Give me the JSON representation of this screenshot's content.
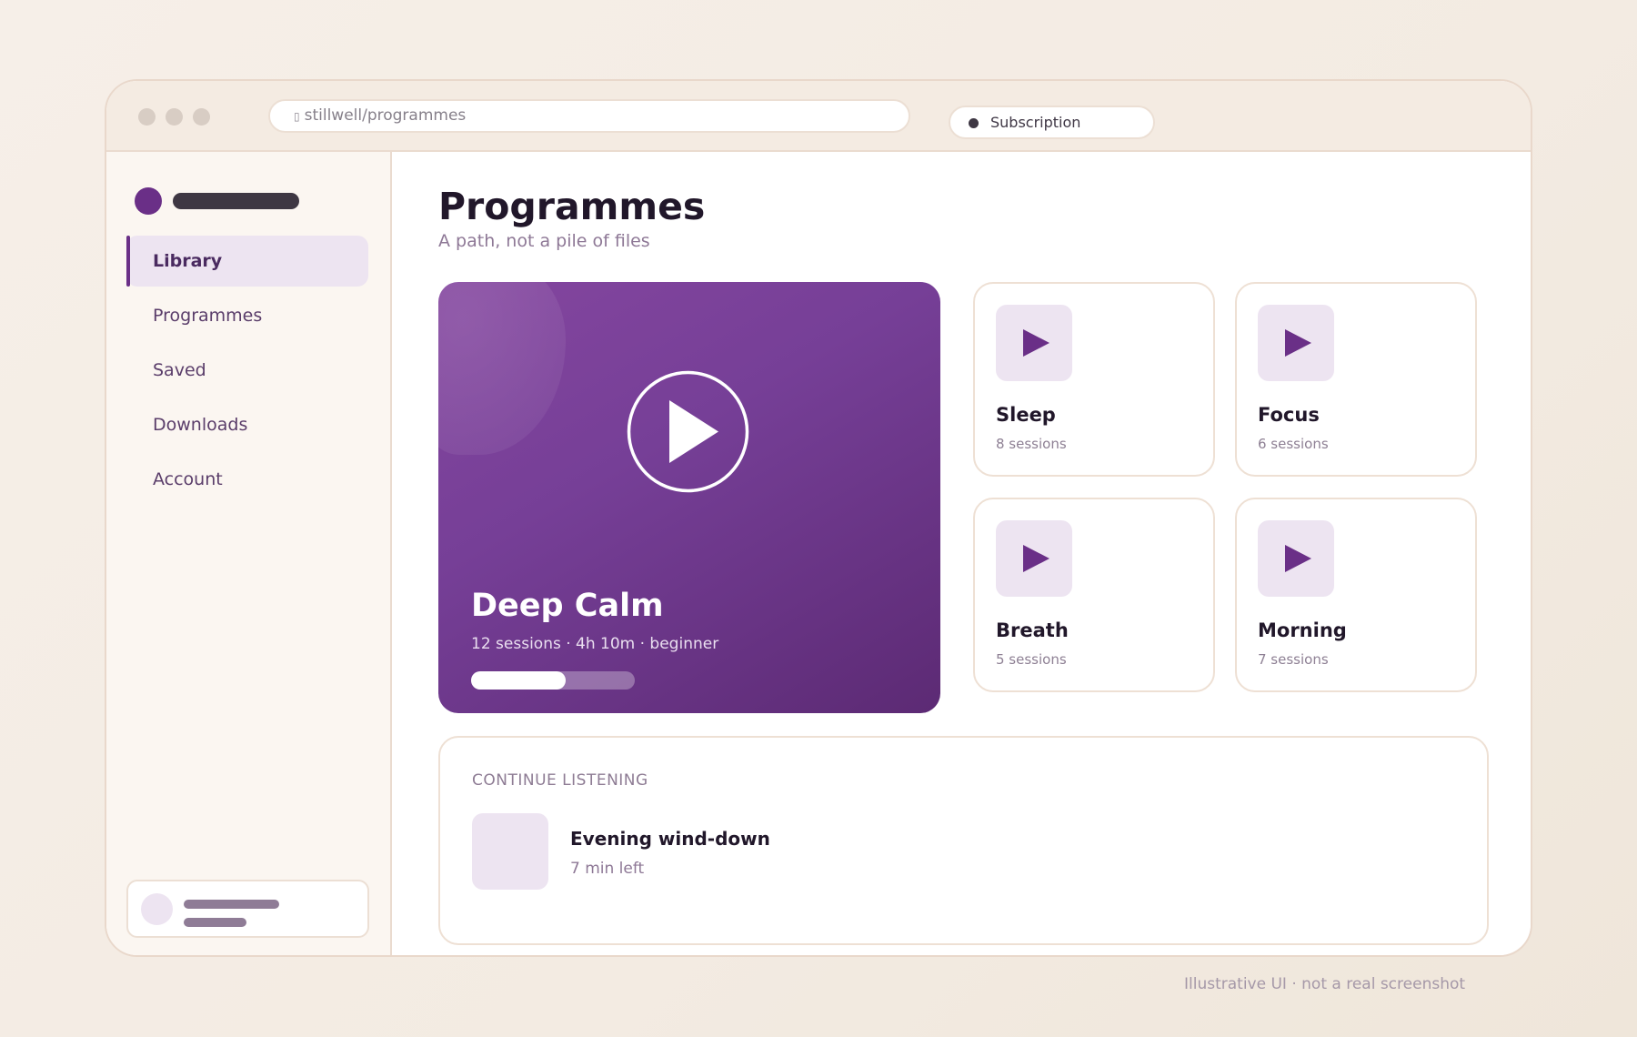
{
  "browser": {
    "url": "stillwell/programmes",
    "url_icon": "lock-icon",
    "subscription_label": "Subscription"
  },
  "sidebar": {
    "items": [
      {
        "label": "Library",
        "active": true
      },
      {
        "label": "Programmes",
        "active": false
      },
      {
        "label": "Saved",
        "active": false
      },
      {
        "label": "Downloads",
        "active": false
      },
      {
        "label": "Account",
        "active": false
      }
    ]
  },
  "main": {
    "title": "Programmes",
    "subtitle": "A path, not a pile of files"
  },
  "hero": {
    "title": "Deep Calm",
    "meta": "12 sessions · 4h 10m · beginner",
    "progress": 0.58,
    "icon": "play-circle-icon"
  },
  "tiles": [
    {
      "name": "Sleep",
      "count": "8 sessions",
      "icon": "play-icon"
    },
    {
      "name": "Focus",
      "count": "6 sessions",
      "icon": "play-icon"
    },
    {
      "name": "Breath",
      "count": "5 sessions",
      "icon": "play-icon"
    },
    {
      "name": "Morning",
      "count": "7 sessions",
      "icon": "play-icon"
    }
  ],
  "continue": {
    "heading": "CONTINUE LISTENING",
    "title": "Evening wind-down",
    "meta": "7 min left"
  },
  "footnote": "Illustrative UI · not a real screenshot",
  "colors": {
    "accent": "#6a2f87",
    "accent_soft": "#ede4f1",
    "background": "#f6efe8"
  }
}
